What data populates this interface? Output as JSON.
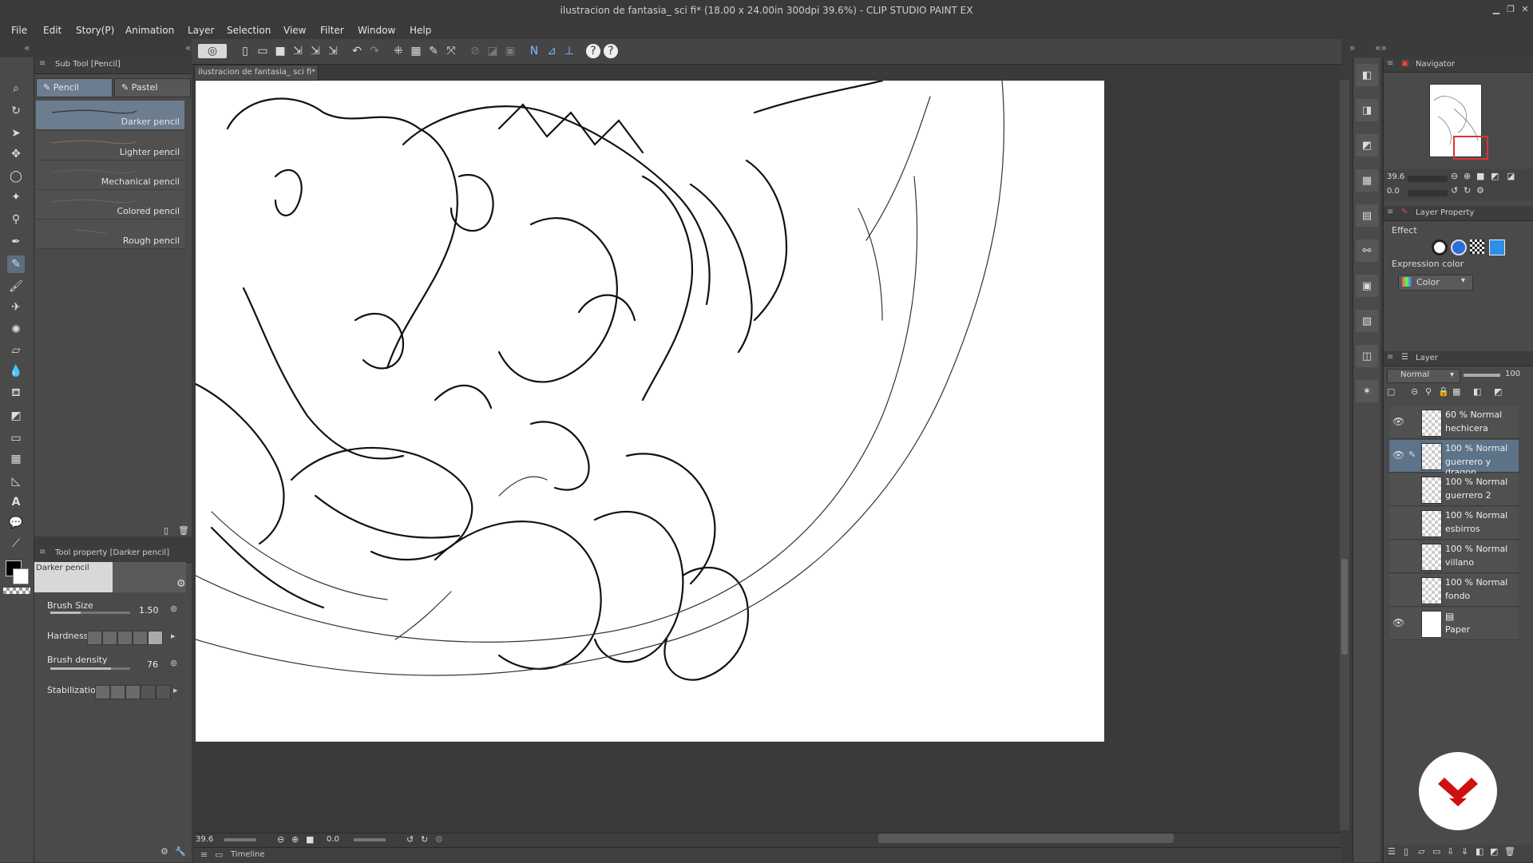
{
  "window": {
    "title": "ilustracion de fantasia_ sci fi* (18.00 x 24.00in 300dpi 39.6%) - CLIP STUDIO PAINT EX"
  },
  "menu": [
    "File",
    "Edit",
    "Story(P)",
    "Animation",
    "Layer",
    "Selection",
    "View",
    "Filter",
    "Window",
    "Help"
  ],
  "sub_tool": {
    "panel_title": "Sub Tool [Pencil]",
    "tabs": [
      "Pencil",
      "Pastel"
    ],
    "brushes": [
      "Darker pencil",
      "Lighter pencil",
      "Mechanical pencil",
      "Colored pencil",
      "Rough pencil"
    ]
  },
  "tool_property": {
    "panel_title": "Tool property [Darker pencil]",
    "preview_name": "Darker pencil",
    "brush_size_label": "Brush Size",
    "brush_size_value": "1.50",
    "hardness_label": "Hardness",
    "brush_density_label": "Brush density",
    "brush_density_value": "76",
    "stabilization_label": "Stabilization"
  },
  "document": {
    "tab_label": "ilustracion de fantasia_ sci fi*"
  },
  "status": {
    "zoom": "39.6",
    "angle": "0.0",
    "timeline_label": "Timeline"
  },
  "navigator": {
    "title": "Navigator",
    "zoom": "39.6",
    "angle": "0.0"
  },
  "layer_property": {
    "title": "Layer Property",
    "effect_label": "Effect",
    "expression_color_label": "Expression color",
    "expression_color_value": "Color"
  },
  "layers_panel": {
    "title": "Layer",
    "blend_mode": "Normal",
    "opacity": "100",
    "layers": [
      {
        "mode": "60 % Normal",
        "name": "hechicera"
      },
      {
        "mode": "100 % Normal",
        "name": "guerrero y dragon"
      },
      {
        "mode": "100 % Normal",
        "name": "guerrero 2"
      },
      {
        "mode": "100 % Normal",
        "name": "esbirros"
      },
      {
        "mode": "100 % Normal",
        "name": "villano"
      },
      {
        "mode": "100 % Normal",
        "name": "fondo"
      },
      {
        "mode": "",
        "name": "Paper"
      }
    ]
  },
  "colors": {
    "selection": "#6c7d8f",
    "logo_red": "#d01010"
  }
}
